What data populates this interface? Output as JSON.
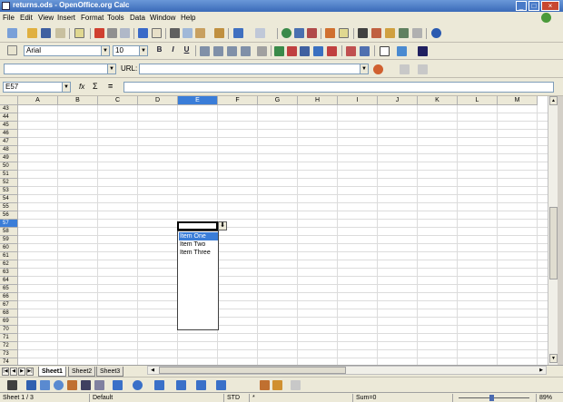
{
  "window": {
    "title": "returns.ods - OpenOffice.org Calc"
  },
  "menubar": {
    "items": [
      "File",
      "Edit",
      "View",
      "Insert",
      "Format",
      "Tools",
      "Data",
      "Window",
      "Help"
    ]
  },
  "formatting": {
    "font_name": "Arial",
    "font_size": "10",
    "bold": "B",
    "italic": "I",
    "underline": "U"
  },
  "hyperlink_bar": {
    "url_label": "URL:",
    "url_value": ""
  },
  "formula_bar": {
    "cell_ref": "E57",
    "fx_label": "fx",
    "sum_label": "Σ",
    "equals_label": "=",
    "content": ""
  },
  "grid": {
    "columns": [
      "A",
      "B",
      "C",
      "D",
      "E",
      "F",
      "G",
      "H",
      "I",
      "J",
      "K",
      "L",
      "M"
    ],
    "active_column": "E",
    "rows": [
      "43",
      "44",
      "45",
      "46",
      "47",
      "48",
      "49",
      "50",
      "51",
      "52",
      "53",
      "54",
      "55",
      "56",
      "57",
      "58",
      "59",
      "60",
      "61",
      "62",
      "63",
      "64",
      "65",
      "66",
      "67",
      "68",
      "69",
      "70",
      "71",
      "72",
      "73",
      "74"
    ],
    "active_row": "57"
  },
  "dropdown_list": {
    "items": [
      "Item One",
      "Item Two",
      "Item Three"
    ],
    "selected_index": 0
  },
  "sheet_tabs": [
    "Sheet1",
    "Sheet2",
    "Sheet3"
  ],
  "active_sheet": "Sheet1",
  "status": {
    "sheet": "Sheet 1 / 3",
    "page_style": "Default",
    "mode": "STD",
    "modified": "*",
    "sum": "Sum=0",
    "zoom": "89%"
  },
  "colors": {
    "selection": "#3a7dd8",
    "header_active": "#3a7dd8",
    "toolbar_bg": "#ece9d8"
  }
}
